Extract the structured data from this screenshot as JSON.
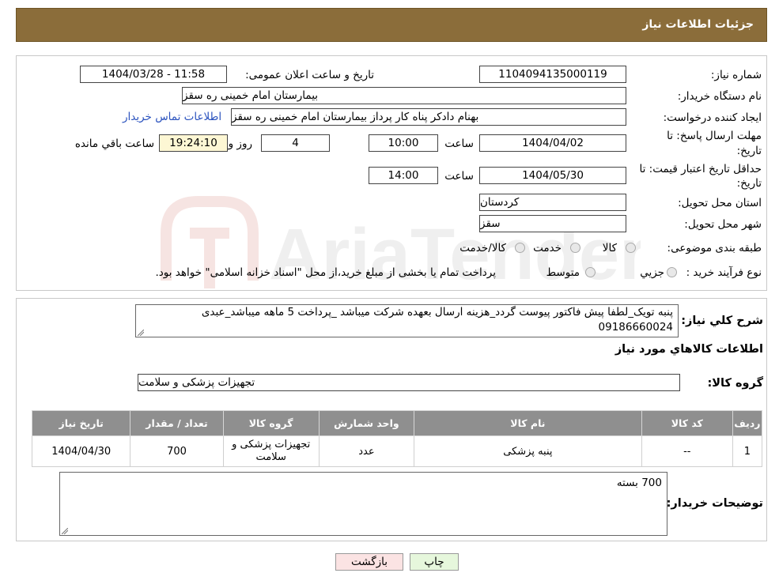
{
  "header": {
    "title": "جزئیات اطلاعات نیاز"
  },
  "form": {
    "need_number_label": "شماره نیاز:",
    "need_number": "1104094135000119",
    "announce_label": "تاریخ و ساعت اعلان عمومی:",
    "announce_value": "1404/03/28 - 11:58",
    "buyer_org_label": "نام دستگاه خریدار:",
    "buyer_org": "بیمارستان امام خمینی  ره  سقز",
    "creator_label": "ایجاد کننده درخواست:",
    "creator": "بهنام دادکر پناه کار پرداز بیمارستان امام خمینی  ره  سقز",
    "contact_link": "اطلاعات تماس خریدار",
    "deadline_label_1": "مهلت ارسال پاسخ: تا",
    "deadline_label_2": "تاریخ:",
    "deadline_date": "1404/04/02",
    "time_label": "ساعت",
    "deadline_time": "10:00",
    "days_value": "4",
    "days_label": "روز و",
    "remaining_time": "19:24:10",
    "remaining_label": "ساعت باقي مانده",
    "validity_label_1": "حداقل تاریخ اعتبار قیمت: تا",
    "validity_label_2": "تاریخ:",
    "validity_date": "1404/05/30",
    "validity_time_label": "ساعت",
    "validity_time": "14:00",
    "province_label": "استان محل تحویل:",
    "province": "کردستان",
    "city_label": "شهر محل تحویل:",
    "city": "سقز",
    "category_label": "طبقه بندی موضوعی:",
    "category_options": [
      "کالا",
      "خدمت",
      "کالا/خدمت"
    ],
    "process_label": "نوع فرآیند خرید :",
    "process_options": [
      "جزيي",
      "متوسط"
    ],
    "process_note": "پرداخت تمام یا بخشی از مبلغ خرید،از محل \"اسناد خزانه اسلامی\" خواهد بود."
  },
  "details": {
    "description_label": "شرح کلي نياز:",
    "description": "پنبه تویک_لطفا پیش فاکتور پیوست گردد_هزینه ارسال بعهده شرکت میباشد _پرداخت 5 ماهه میباشد_عبدی 09186660024",
    "goods_info_title": "اطلاعات کالاهاي مورد نياز",
    "goods_group_label": "گروه کالا:",
    "goods_group": "تجهیزات پزشکی و سلامت",
    "table": {
      "headers": [
        "رديف",
        "کد کالا",
        "نام کالا",
        "واحد شمارش",
        "گروه کالا",
        "تعداد / مقدار",
        "تاریخ نیاز"
      ],
      "rows": [
        [
          "1",
          "--",
          "پنبه پزشکی",
          "عدد",
          "تجهیزات پزشکی و سلامت",
          "700",
          "1404/04/30"
        ]
      ]
    },
    "buyer_notes_label": "توضیحات خریدار:",
    "buyer_notes": "700 بسته"
  },
  "buttons": {
    "print": "چاپ",
    "back": "بازگشت"
  },
  "watermark": {
    "text": "AriaTender.neT"
  }
}
